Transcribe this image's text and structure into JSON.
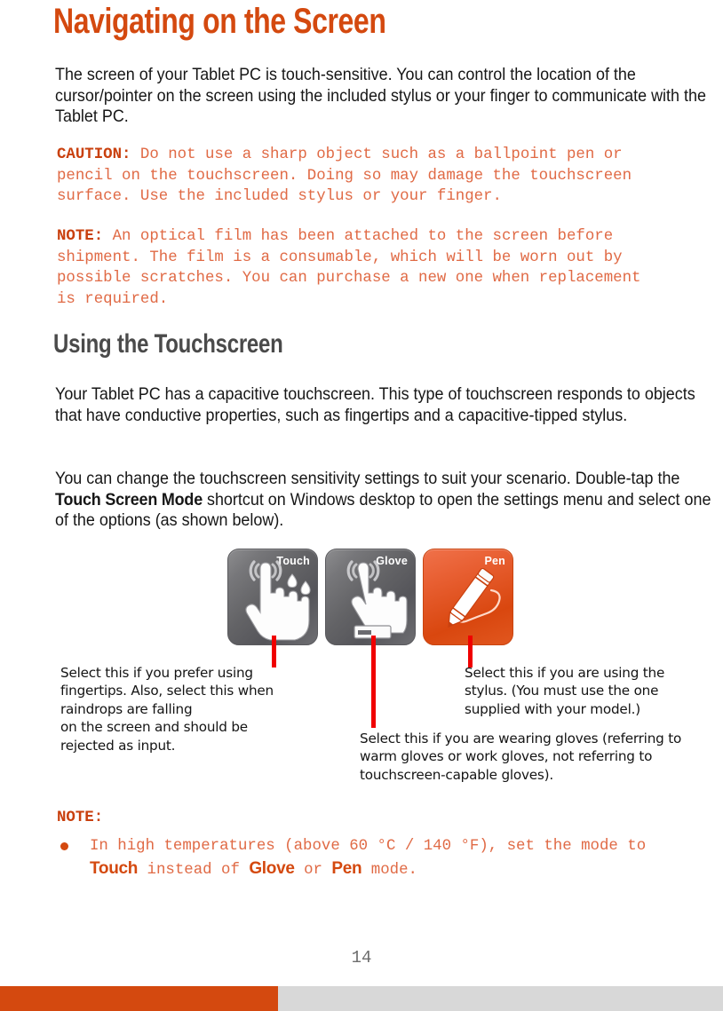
{
  "document": {
    "page_number": "14",
    "colors": {
      "heading_orange": "#d4490f",
      "subheading_gray": "#4a4a4a",
      "note_text_orange": "#e06a45",
      "note_tag_orange": "#c9400e",
      "leader_line_red": "#f00000",
      "footer_orange": "#d4490f",
      "footer_gray": "#d8d8d8"
    }
  },
  "headings": {
    "title": "Navigating on the Screen",
    "section": "Using the Touchscreen"
  },
  "paragraphs": {
    "intro": "The screen of your Tablet PC is touch-sensitive. You can control the location of the cursor/pointer on the screen using the included stylus or your finger to communicate with the Tablet PC.",
    "capacitive": "Your Tablet PC has a capacitive touchscreen. This type of touchscreen responds to objects that have conductive properties, such as fingertips and a capacitive-tipped stylus.",
    "sensitivity_part1": "You can change the touchscreen sensitivity settings to suit your scenario. Double-tap the ",
    "sensitivity_bold": "Touch Screen Mode",
    "sensitivity_part2": " shortcut on Windows desktop to open the settings menu and select one of the options (as shown below)."
  },
  "caution": {
    "tag": "CAUTION:",
    "text": " Do not use a sharp object such as a ballpoint pen or\npencil on the touchscreen. Doing so may damage the touchscreen\nsurface. Use the included stylus or your finger."
  },
  "note_film": {
    "tag": "NOTE:",
    "text": " An optical film has been attached to the screen before\nshipment. The film is a consumable, which will be worn out by\npossible scratches. You can purchase a new one when replacement\nis required."
  },
  "figure": {
    "buttons": [
      {
        "label": "Touch",
        "style": "gray",
        "icon": "hand-touch-with-water-drops-icon"
      },
      {
        "label": "Glove",
        "style": "gray",
        "icon": "gloved-hand-touch-icon"
      },
      {
        "label": "Pen",
        "style": "orange",
        "icon": "stylus-pen-icon"
      }
    ],
    "captions": {
      "touch": "Select this if you prefer using\nfingertips. Also, select this when\nraindrops are falling\non the screen and should be\nrejected as input.",
      "pen": "Select this if you are using the\nstylus. (You must use the one\nsupplied with your model.)",
      "glove": "Select this if you are wearing gloves (referring to\nwarm gloves or work gloves, not referring to\ntouchscreen-capable gloves)."
    }
  },
  "note_temperature": {
    "tag": "NOTE:",
    "bullet": {
      "part1": "In high temperatures (above 60 °C / 140 °F), set the mode to",
      "kw1": "Touch",
      "mid1": " instead of ",
      "kw2": "Glove",
      "mid2": " or ",
      "kw3": "Pen",
      "tail": " mode."
    }
  }
}
